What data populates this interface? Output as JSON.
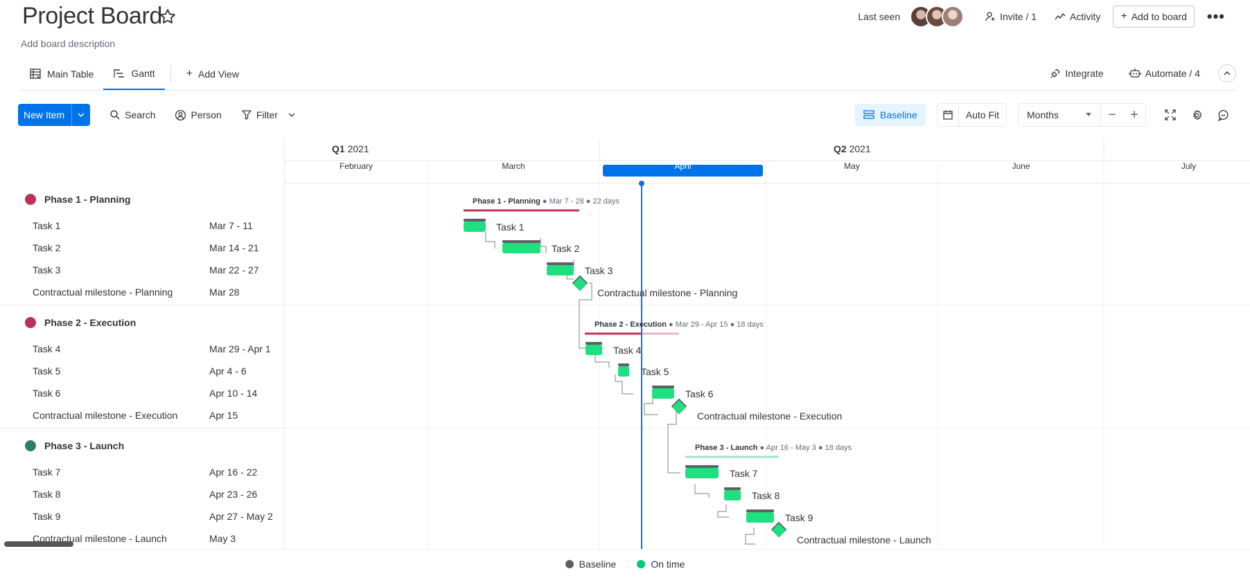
{
  "board": {
    "title": "Project Board",
    "description": "Add board description",
    "last_seen_label": "Last seen",
    "invite_label": "Invite / 1",
    "activity_label": "Activity",
    "add_to_board_label": "Add to board",
    "more_label": "•••"
  },
  "tabs": {
    "main_table": "Main Table",
    "gantt": "Gantt",
    "add_view": "Add View",
    "integrate": "Integrate",
    "automate": "Automate / 4"
  },
  "toolbar": {
    "new_item": "New Item",
    "search": "Search",
    "person": "Person",
    "filter": "Filter",
    "baseline": "Baseline",
    "auto_fit": "Auto Fit",
    "zoom_unit": "Months",
    "zoom_out": "−",
    "zoom_in": "+"
  },
  "timeline": {
    "quarters": [
      {
        "label": "Q1",
        "year": "2021"
      },
      {
        "label": "Q2",
        "year": "2021"
      }
    ],
    "months": [
      "February",
      "March",
      "April",
      "May",
      "June",
      "July"
    ],
    "current_month": "April"
  },
  "groups": [
    {
      "name": "Phase 1 - Planning",
      "color": "#bb3354",
      "summary_range": "Mar 7 - 28",
      "summary_days": "22 days",
      "tasks": [
        {
          "name": "Task 1",
          "dates": "Mar 7 - 11",
          "type": "task"
        },
        {
          "name": "Task 2",
          "dates": "Mar 14 - 21",
          "type": "task"
        },
        {
          "name": "Task 3",
          "dates": "Mar 22 - 27",
          "type": "task"
        },
        {
          "name": "Contractual milestone - Planning",
          "dates": "Mar 28",
          "type": "milestone"
        }
      ]
    },
    {
      "name": "Phase 2 - Execution",
      "color": "#bb3354",
      "summary_range": "Mar 29 - Apr 15",
      "summary_days": "18 days",
      "tasks": [
        {
          "name": "Task 4",
          "dates": "Mar 29 - Apr 1",
          "type": "task"
        },
        {
          "name": "Task 5",
          "dates": "Apr 4 - 6",
          "type": "task"
        },
        {
          "name": "Task 6",
          "dates": "Apr 10 - 14",
          "type": "task"
        },
        {
          "name": "Contractual milestone - Execution",
          "dates": "Apr 15",
          "type": "milestone"
        }
      ]
    },
    {
      "name": "Phase 3 - Launch",
      "color": "#2e7d6b",
      "summary_range": "Apr 16 - May 3",
      "summary_days": "18 days",
      "tasks": [
        {
          "name": "Task 7",
          "dates": "Apr 16 - 22",
          "type": "task"
        },
        {
          "name": "Task 8",
          "dates": "Apr 23 - 26",
          "type": "task"
        },
        {
          "name": "Task 9",
          "dates": "Apr 27 - May 2",
          "type": "task"
        },
        {
          "name": "Contractual milestone - Launch",
          "dates": "May 3",
          "type": "milestone"
        }
      ]
    }
  ],
  "legend": {
    "baseline": "Baseline",
    "baseline_color": "#5f6068",
    "on_time": "On time",
    "on_time_color": "#00ca72"
  },
  "colors": {
    "primary": "#0073ea",
    "task_green": "#1ee07f",
    "baseline_dark": "#5f6068",
    "today_line": "#0073ea",
    "phase3_line": "#9fe6c4"
  }
}
